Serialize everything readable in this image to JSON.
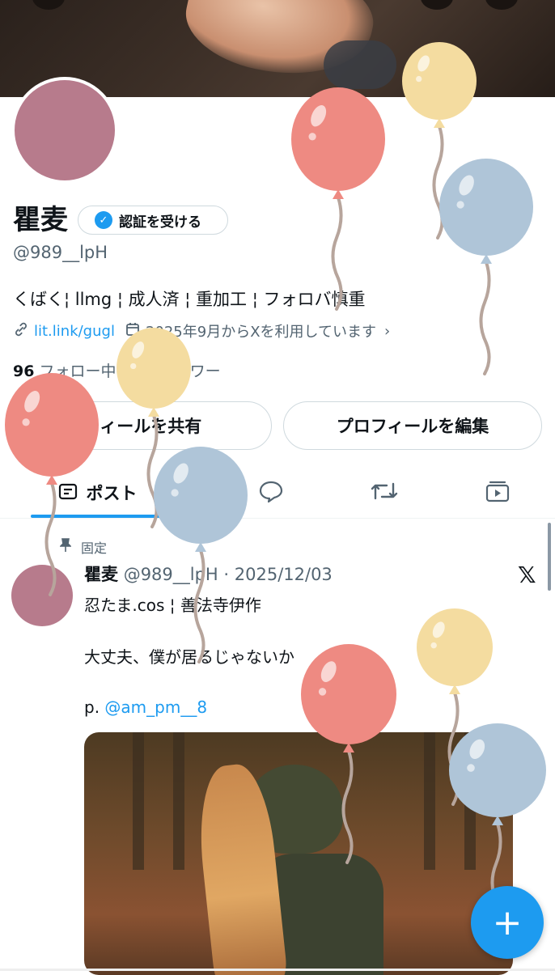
{
  "profile": {
    "name": "瞿麦",
    "verify_label": "認証を受ける",
    "handle": "@989__lpH",
    "bio": "くばく¦ llmg ¦ 成人済 ¦ 重加工 ¦ フォロバ慎重",
    "link": "lit.link/gugl",
    "joined": "2025年9月からXを利用しています",
    "following_count": "96",
    "following_label": "フォロー中",
    "followers_label": "フォロワー",
    "share_button": "フィールを共有",
    "edit_button": "プロフィールを編集"
  },
  "tabs": {
    "posts": "ポスト"
  },
  "post": {
    "pinned_label": "固定",
    "author": "瞿麦",
    "meta": "@989__lpH · 2025/12/03",
    "line1": "忍たま.cos ¦ 善法寺伊作",
    "line2": "大丈夫、僕が居るじゃないか",
    "line3_prefix": "p.",
    "line3_mention": "@am_pm__8",
    "x_logo": "𝕏"
  },
  "fab": {
    "label": "+"
  },
  "colors": {
    "accent": "#1d9bf0",
    "balloon_red": "#ee8a82",
    "balloon_yellow": "#f4dca0",
    "balloon_blue": "#afc5d8",
    "avatar": "#b77b8c"
  },
  "icons": [
    "link-icon",
    "calendar-icon",
    "chevron-right-icon",
    "verified-badge-icon",
    "posts-tab-icon",
    "replies-icon",
    "reposts-icon",
    "media-icon",
    "pin-icon",
    "plus-icon"
  ]
}
